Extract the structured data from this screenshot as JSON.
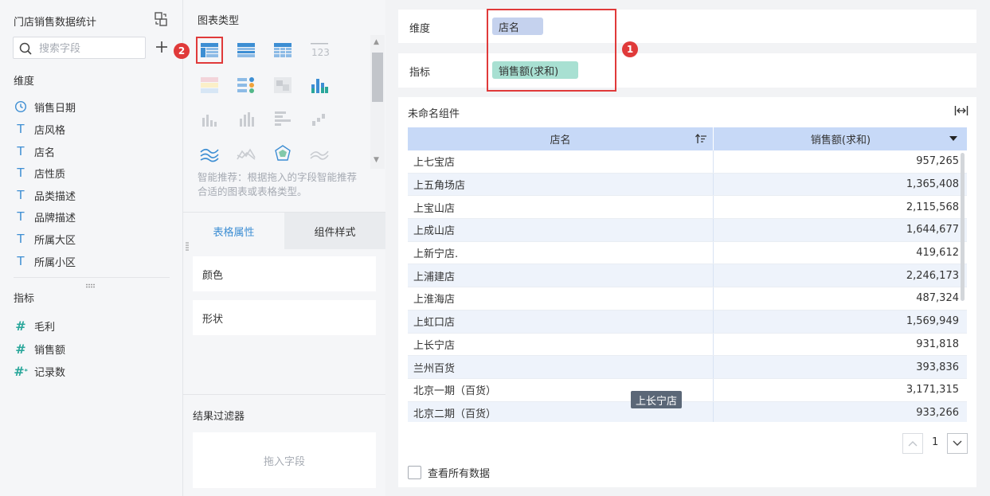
{
  "left": {
    "dataset_title": "门店销售数据统计",
    "search_placeholder": "搜索字段",
    "dimension_label": "维度",
    "dimensions": [
      {
        "icon": "clock-icon",
        "label": "销售日期"
      },
      {
        "icon": "text-type-icon",
        "label": "店风格"
      },
      {
        "icon": "text-type-icon",
        "label": "店名"
      },
      {
        "icon": "text-type-icon",
        "label": "店性质"
      },
      {
        "icon": "text-type-icon",
        "label": "品类描述"
      },
      {
        "icon": "text-type-icon",
        "label": "品牌描述"
      },
      {
        "icon": "text-type-icon",
        "label": "所属大区"
      },
      {
        "icon": "text-type-icon",
        "label": "所属小区"
      }
    ],
    "metric_label": "指标",
    "metrics": [
      {
        "icon": "hash-icon",
        "label": "毛利"
      },
      {
        "icon": "hash-icon",
        "label": "销售额"
      },
      {
        "icon": "hash-star-icon",
        "label": "记录数"
      }
    ]
  },
  "middle": {
    "chart_type_title": "图表类型",
    "recommend_text": "智能推荐：根据拖入的字段智能推荐合适的图表或表格类型。",
    "tabs": [
      {
        "label": "表格属性",
        "active": true
      },
      {
        "label": "组件样式",
        "active": false
      }
    ],
    "props": [
      "颜色",
      "形状"
    ],
    "filter_title": "结果过滤器",
    "filter_placeholder": "拖入字段",
    "badge_number": "2"
  },
  "right": {
    "dimension_label": "维度",
    "dimension_pill": "店名",
    "metric_label": "指标",
    "metric_pill": "销售额(求和)",
    "badge_number": "1",
    "widget_title": "未命名组件",
    "columns": [
      "店名",
      "销售额(求和)"
    ],
    "rows": [
      [
        "上七宝店",
        "957,265"
      ],
      [
        "上五角场店",
        "1,365,408"
      ],
      [
        "上宝山店",
        "2,115,568"
      ],
      [
        "上成山店",
        "1,644,677"
      ],
      [
        "上新宁店.",
        "419,612"
      ],
      [
        "上浦建店",
        "2,246,173"
      ],
      [
        "上淮海店",
        "487,324"
      ],
      [
        "上虹口店",
        "1,569,949"
      ],
      [
        "上长宁店",
        "931,818"
      ],
      [
        "兰州百货",
        "393,836"
      ],
      [
        "北京一期（百货）",
        "3,171,315"
      ],
      [
        "北京二期（百货）",
        "933,266"
      ]
    ],
    "tooltip": "上长宁店",
    "page_number": "1",
    "view_all_label": "查看所有数据"
  },
  "colors": {
    "accent": "#3d8ed3",
    "highlight_red": "#e03a3a",
    "dim_pill": "#c5d2ee",
    "metric_pill": "#a8e0d2",
    "table_header": "#c7d9f7"
  }
}
